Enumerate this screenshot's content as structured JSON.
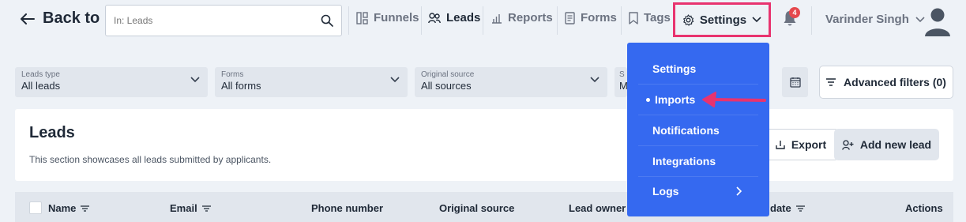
{
  "header": {
    "back_label": "Back to",
    "search_placeholder": "In: Leads",
    "nav": {
      "funnels": "Funnels",
      "leads": "Leads",
      "reports": "Reports",
      "forms": "Forms",
      "tags": "Tags",
      "settings": "Settings"
    },
    "notification_count": "4",
    "user_name": "Varinder Singh"
  },
  "filters": [
    {
      "label": "Leads type",
      "value": "All leads"
    },
    {
      "label": "Forms",
      "value": "All forms"
    },
    {
      "label": "Original source",
      "value": "All sources"
    },
    {
      "label": "S",
      "value": "M"
    }
  ],
  "advanced_filters_label": "Advanced filters (0)",
  "section": {
    "title": "Leads",
    "description": "This section showcases all leads submitted by applicants.",
    "export_label": "Export",
    "add_label": "Add new lead"
  },
  "table": {
    "columns": [
      "Name",
      "Email",
      "Phone number",
      "Original source",
      "Lead owner",
      "date",
      "Actions"
    ]
  },
  "settings_menu": {
    "items": [
      "Settings",
      "Imports",
      "Notifications",
      "Integrations",
      "Logs"
    ]
  },
  "colors": {
    "menu_bg": "#3569f0",
    "highlight": "#e8336f",
    "page_bg": "#eef2f7"
  }
}
